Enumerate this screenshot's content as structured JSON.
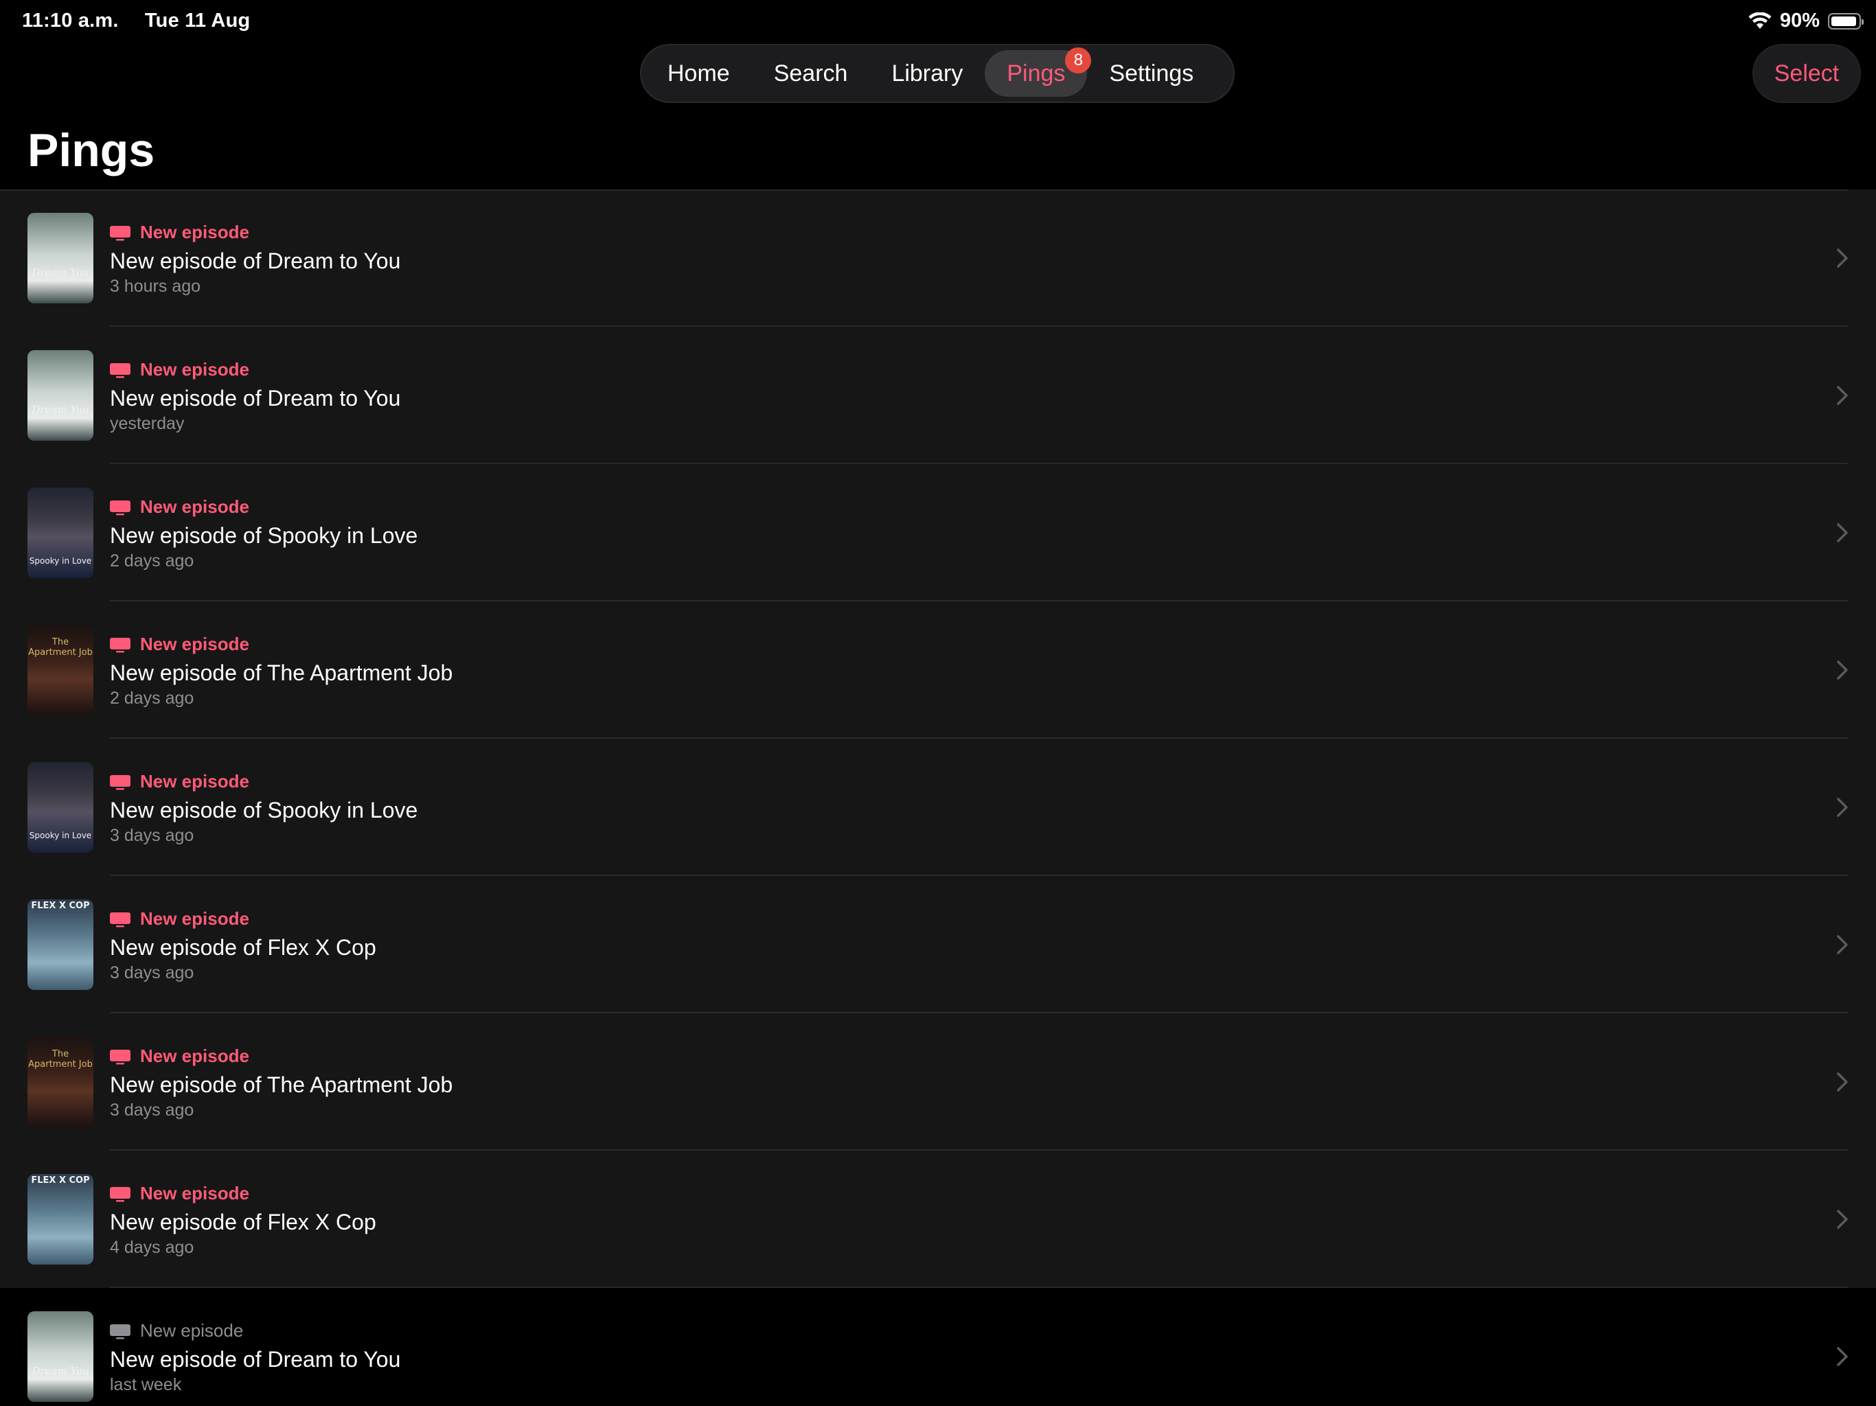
{
  "status_bar": {
    "time": "11:10 a.m.",
    "date": "Tue 11 Aug",
    "battery_percent": "90%",
    "battery_level": 0.9
  },
  "tabs": [
    {
      "label": "Home"
    },
    {
      "label": "Search"
    },
    {
      "label": "Library"
    },
    {
      "label": "Pings",
      "badge": "8",
      "active": true
    },
    {
      "label": "Settings"
    }
  ],
  "select_label": "Select",
  "page_title": "Pings",
  "accent_color": "#ff5a78",
  "items": [
    {
      "kind": "New episode",
      "title": "New episode of Dream to You",
      "time": "3 hours ago",
      "show": "dream"
    },
    {
      "kind": "New episode",
      "title": "New episode of Dream to You",
      "time": "yesterday",
      "show": "dream"
    },
    {
      "kind": "New episode",
      "title": "New episode of Spooky in Love",
      "time": "2 days ago",
      "show": "spooky"
    },
    {
      "kind": "New episode",
      "title": "New episode of The Apartment Job",
      "time": "2 days ago",
      "show": "apartment"
    },
    {
      "kind": "New episode",
      "title": "New episode of Spooky in Love",
      "time": "3 days ago",
      "show": "spooky"
    },
    {
      "kind": "New episode",
      "title": "New episode of Flex X Cop",
      "time": "3 days ago",
      "show": "flex"
    },
    {
      "kind": "New episode",
      "title": "New episode of The Apartment Job",
      "time": "3 days ago",
      "show": "apartment"
    },
    {
      "kind": "New episode",
      "title": "New episode of Flex X Cop",
      "time": "4 days ago",
      "show": "flex"
    },
    {
      "kind": "New episode",
      "title": "New episode of Dream to You",
      "time": "last week",
      "show": "dream",
      "read": true
    }
  ],
  "thumb_labels": {
    "dream": "Dream You",
    "spooky": "Spooky in Love",
    "apartment": "The Apartment Job",
    "flex": "FLEX X COP"
  }
}
